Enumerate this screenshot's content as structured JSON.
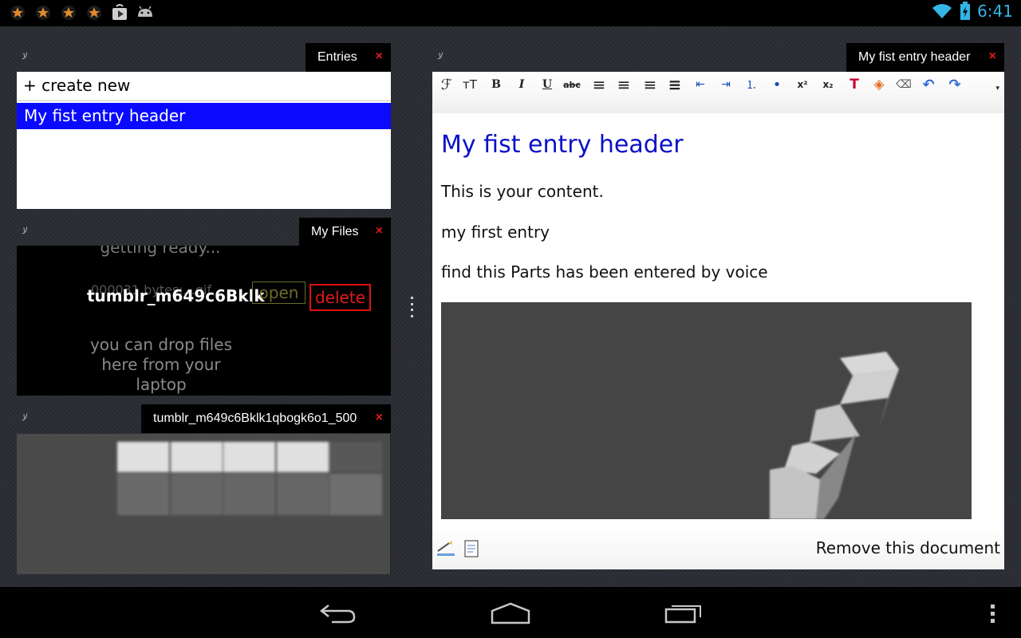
{
  "status_bar": {
    "time": "6:41",
    "left_icons": [
      "star-icon",
      "star-icon",
      "star-icon",
      "star-icon",
      "play-store-icon",
      "android-icon"
    ],
    "right_icons": [
      "wifi-icon",
      "battery-icon"
    ],
    "accent_color": "#33b5e5"
  },
  "entries_panel": {
    "tab_label": "Entries",
    "close_label": "×",
    "create_new": "+ create new",
    "items": [
      {
        "label": "My fist entry header",
        "selected": true
      }
    ]
  },
  "files_panel": {
    "tab_label": "My Files",
    "close_label": "×",
    "status_text": "getting ready...",
    "file_name": "tumblr_m649c6Bklk",
    "file_name_underlay": "000031 bytes:...gif",
    "open_label": "open",
    "delete_label": "delete",
    "drop_hint": "you can drop files here from your laptop"
  },
  "image_panel": {
    "tab_label": "tumblr_m649c6Bklk1qbogk6o1_500",
    "close_label": "×"
  },
  "editor_panel": {
    "tab_label": "My fist entry header",
    "close_label": "×",
    "toolbar": [
      {
        "name": "font-family-icon",
        "glyph": "ℱ"
      },
      {
        "name": "font-size-icon",
        "glyph": "тT"
      },
      {
        "name": "bold-icon",
        "glyph": "B"
      },
      {
        "name": "italic-icon",
        "glyph": "I"
      },
      {
        "name": "underline-icon",
        "glyph": "U"
      },
      {
        "name": "strikethrough-icon",
        "glyph": "abc"
      },
      {
        "name": "align-left-icon",
        "glyph": "≡"
      },
      {
        "name": "align-center-icon",
        "glyph": "≡"
      },
      {
        "name": "align-right-icon",
        "glyph": "≡"
      },
      {
        "name": "justify-icon",
        "glyph": "≡"
      },
      {
        "name": "outdent-icon",
        "glyph": "⇤"
      },
      {
        "name": "indent-icon",
        "glyph": "⇥"
      },
      {
        "name": "ordered-list-icon",
        "glyph": "⒈"
      },
      {
        "name": "unordered-list-icon",
        "glyph": "•"
      },
      {
        "name": "superscript-icon",
        "glyph": "x²"
      },
      {
        "name": "subscript-icon",
        "glyph": "x₂"
      },
      {
        "name": "text-color-icon",
        "glyph": "T"
      },
      {
        "name": "fill-color-icon",
        "glyph": "◈"
      },
      {
        "name": "eraser-icon",
        "glyph": "⌫"
      },
      {
        "name": "undo-icon",
        "glyph": "↶"
      },
      {
        "name": "redo-icon",
        "glyph": "↷"
      }
    ],
    "doc_title": "My fist entry header",
    "paragraphs": [
      "This is your content.",
      "my first entry",
      "find this Parts has been entered by voice"
    ],
    "remove_label": "Remove this document"
  },
  "nav_bar": {
    "buttons": [
      "back-icon",
      "home-icon",
      "recents-icon",
      "overflow-menu-icon"
    ]
  }
}
